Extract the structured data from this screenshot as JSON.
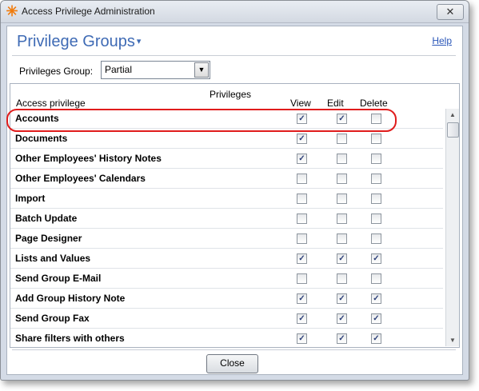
{
  "window": {
    "title": "Access Privilege Administration",
    "close_glyph": "✕",
    "app_icon": "asterisk-icon"
  },
  "header": {
    "heading": "Privilege Groups",
    "heading_caret": "▾",
    "help_label": "Help"
  },
  "group_select": {
    "label": "Privileges Group:",
    "value": "Partial",
    "arrow": "▼"
  },
  "grid": {
    "privileges_header": "Privileges",
    "access_header": "Access privilege",
    "view_header": "View",
    "edit_header": "Edit",
    "delete_header": "Delete",
    "rows": [
      {
        "name": "Accounts",
        "view": true,
        "edit": true,
        "delete": false
      },
      {
        "name": "Documents",
        "view": true,
        "edit": false,
        "delete": false
      },
      {
        "name": "Other Employees' History Notes",
        "view": true,
        "edit": false,
        "delete": false
      },
      {
        "name": "Other Employees' Calendars",
        "view": false,
        "edit": false,
        "delete": false
      },
      {
        "name": "Import",
        "view": false,
        "edit": false,
        "delete": false
      },
      {
        "name": "Batch Update",
        "view": false,
        "edit": false,
        "delete": false
      },
      {
        "name": "Page Designer",
        "view": false,
        "edit": false,
        "delete": false
      },
      {
        "name": "Lists and Values",
        "view": true,
        "edit": true,
        "delete": true
      },
      {
        "name": "Send Group E-Mail",
        "view": false,
        "edit": false,
        "delete": false
      },
      {
        "name": "Add Group History Note",
        "view": true,
        "edit": true,
        "delete": true
      },
      {
        "name": "Send Group Fax",
        "view": true,
        "edit": true,
        "delete": true
      },
      {
        "name": "Share filters with others",
        "view": true,
        "edit": true,
        "delete": true
      }
    ],
    "scroll_up": "▲",
    "scroll_down": "▼"
  },
  "footer": {
    "close_label": "Close"
  },
  "colors": {
    "heading": "#3f6bb5",
    "highlight": "#e01c1c",
    "link": "#2a56b8"
  }
}
